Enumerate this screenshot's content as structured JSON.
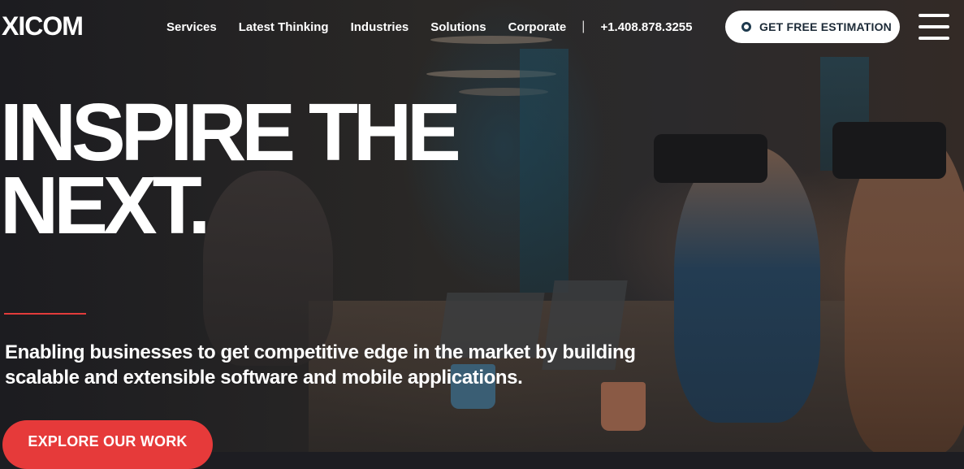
{
  "brand": {
    "logo_text": "XICOM"
  },
  "nav": {
    "items": [
      {
        "label": "Services"
      },
      {
        "label": "Latest Thinking"
      },
      {
        "label": "Industries"
      },
      {
        "label": "Solutions"
      },
      {
        "label": "Corporate"
      }
    ],
    "separator": "|",
    "phone": "+1.408.878.3255"
  },
  "cta": {
    "label": "GET FREE ESTIMATION"
  },
  "hero": {
    "headline_line1": "INSPIRE THE",
    "headline_line2": "NEXT.",
    "subtext": "Enabling businesses to get competitive edge in the market by building scalable and extensible software and mobile applications.",
    "button_label": "EXPLORE OUR WORK"
  },
  "colors": {
    "accent": "#e63a3a",
    "cta_bg": "#ffffff",
    "cta_text": "#1c2a37",
    "text": "#ffffff"
  },
  "icons": {
    "cta": "ring-dot-icon",
    "menu": "hamburger-menu-icon"
  }
}
